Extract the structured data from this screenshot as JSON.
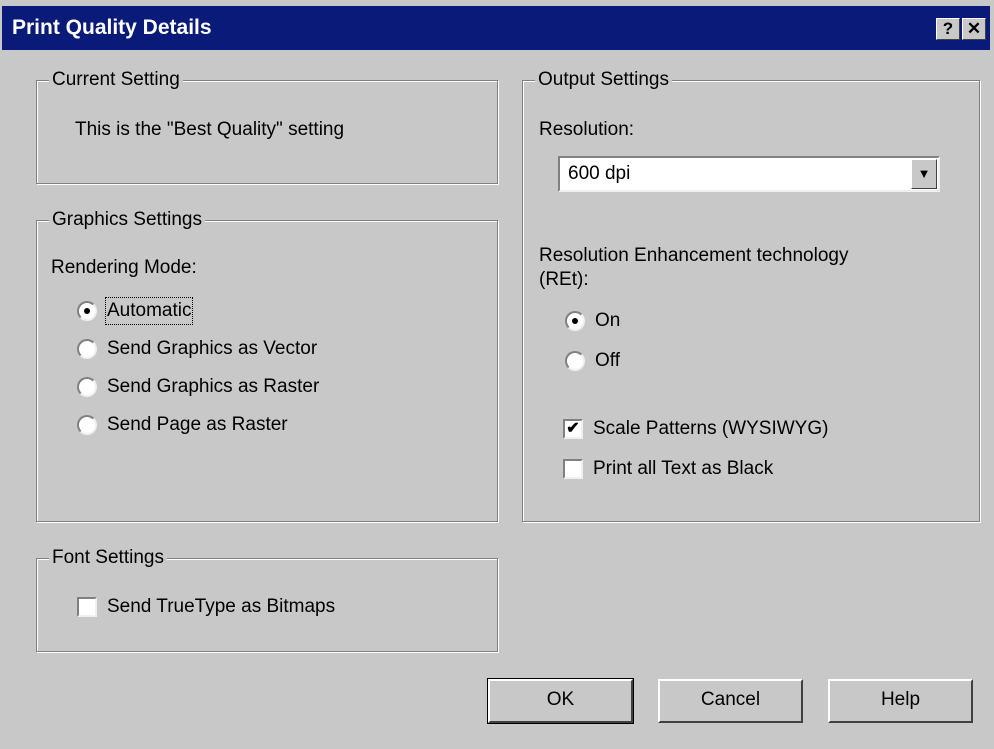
{
  "window": {
    "title": "Print Quality Details",
    "help_glyph": "?",
    "close_glyph": "✕"
  },
  "current_setting": {
    "legend": "Current Setting",
    "text": "This is the \"Best Quality\" setting"
  },
  "graphics": {
    "legend": "Graphics Settings",
    "rendering_label": "Rendering Mode:",
    "options": [
      {
        "label": "Automatic",
        "selected": true
      },
      {
        "label": "Send Graphics as Vector",
        "selected": false
      },
      {
        "label": "Send Graphics as Raster",
        "selected": false
      },
      {
        "label": "Send Page as Raster",
        "selected": false
      }
    ]
  },
  "font": {
    "legend": "Font Settings",
    "truetype_label": "Send TrueType as Bitmaps",
    "truetype_checked": false
  },
  "output": {
    "legend": "Output Settings",
    "resolution_label": "Resolution:",
    "resolution_value": "600 dpi",
    "ret_label_line1": "Resolution Enhancement technology",
    "ret_label_line2": "(REt):",
    "ret_on_label": "On",
    "ret_off_label": "Off",
    "ret_selected": "On",
    "scale_patterns_label": "Scale Patterns (WYSIWYG)",
    "scale_patterns_checked": true,
    "print_black_label": "Print all Text as Black",
    "print_black_checked": false
  },
  "buttons": {
    "ok": "OK",
    "cancel": "Cancel",
    "help": "Help"
  }
}
